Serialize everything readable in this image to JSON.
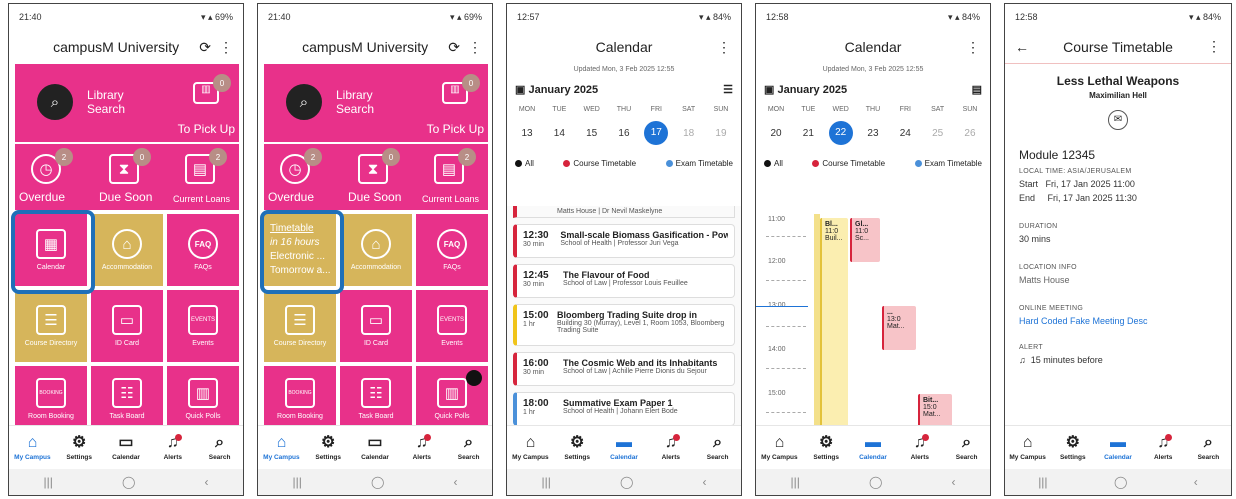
{
  "p1": {
    "status_time": "21:40",
    "title": "campusM University",
    "library_search": "Library\nSearch",
    "to_pick_up": "To Pick Up",
    "to_pick_up_badge": "0",
    "overdue": "Overdue",
    "overdue_badge": "2",
    "due_soon": "Due Soon",
    "due_soon_badge": "0",
    "current_loans": "Current Loans",
    "current_loans_badge": "2",
    "calendar": "Calendar",
    "accommodation": "Accommodation",
    "faqs": "FAQs",
    "faq_icon": "FAQ",
    "course_directory": "Course Directory",
    "id_card": "ID Card",
    "events": "Events",
    "events_icon": "EVENTS",
    "room_booking": "Room Booking",
    "booking_icon": "BOOKING",
    "task_board": "Task Board",
    "quick_polls": "Quick Polls"
  },
  "p2": {
    "status_time": "21:40",
    "tt_line1": "Timetable",
    "tt_line2": "in 16 hours",
    "tt_line3": "Electronic ...",
    "tt_line4": "Tomorrow a..."
  },
  "nav": [
    "My Campus",
    "Settings",
    "Calendar",
    "Alerts",
    "Search"
  ],
  "p3": {
    "status_time": "12:57",
    "title": "Calendar",
    "updated": "Updated Mon, 3 Feb 2025 12:55",
    "month": "January 2025",
    "day_names": [
      "MON",
      "TUE",
      "WED",
      "THU",
      "FRI",
      "SAT",
      "SUN"
    ],
    "days": [
      "13",
      "14",
      "15",
      "16",
      "17",
      "18",
      "19"
    ],
    "filters": [
      "All",
      "Course Timetable",
      "Exam Timetable"
    ],
    "partial_top": "Matts House | Dr Nevil Maskelyne",
    "events": [
      {
        "time": "12:30",
        "dur": "30 min",
        "title": "Small-scale Biomass Gasification - Powe...",
        "sub": "School of Health | Professor Juri Vega",
        "color": "#d6243c"
      },
      {
        "time": "12:45",
        "dur": "30 min",
        "title": "The Flavour of Food",
        "sub": "School of Law | Professor Louis Feuillee",
        "color": "#d6243c"
      },
      {
        "time": "15:00",
        "dur": "1 hr",
        "title": "Bloomberg Trading Suite drop in",
        "sub": "Building 30 (Murray), Level 1, Room 1053, Bloomberg Trading Suite",
        "color": "#f0c419"
      },
      {
        "time": "16:00",
        "dur": "30 min",
        "title": "The Cosmic Web and its Inhabitants",
        "sub": "School of Law | Achille Pierre Dionis du Sejour",
        "color": "#d6243c"
      },
      {
        "time": "18:00",
        "dur": "1 hr",
        "title": "Summative Exam Paper 1",
        "sub": "School of Health | Johann Elert Bode",
        "color": "#4a90d9"
      }
    ]
  },
  "p4": {
    "status_time": "12:58",
    "title": "Calendar",
    "updated": "Updated Mon, 3 Feb 2025 12:55",
    "month": "January 2025",
    "days": [
      "20",
      "21",
      "22",
      "23",
      "24",
      "25",
      "26"
    ],
    "hours": [
      "11:00",
      "12:00",
      "13:00",
      "14:00",
      "15:00"
    ],
    "b1": "Bl...",
    "b1a": "11:0",
    "b1b": "Buil...",
    "b2": "Gl...",
    "b2a": "11:0",
    "b2b": "Sc...",
    "b3": "...",
    "b3a": "13:0",
    "b3b": "Mat...",
    "b4": "Bit...",
    "b4a": "15:0",
    "b4b": "Mat..."
  },
  "p5": {
    "status_time": "12:58",
    "title": "Course Timetable",
    "course": "Less Lethal Weapons",
    "lecturer": "Maximilian Hell",
    "module": "Module 12345",
    "local_time": "LOCAL TIME: ASIA/JERUSALEM",
    "start_label": "Start",
    "start": "Fri, 17 Jan 2025 11:00",
    "end_label": "End",
    "end": "Fri, 17 Jan 2025 11:30",
    "duration_label": "DURATION",
    "duration": "30 mins",
    "location_label": "LOCATION INFO",
    "location": "Matts House",
    "online_label": "ONLINE MEETING",
    "online": "Hard Coded Fake Meeting Desc",
    "alert_label": "ALERT",
    "alert": "15 minutes before"
  }
}
